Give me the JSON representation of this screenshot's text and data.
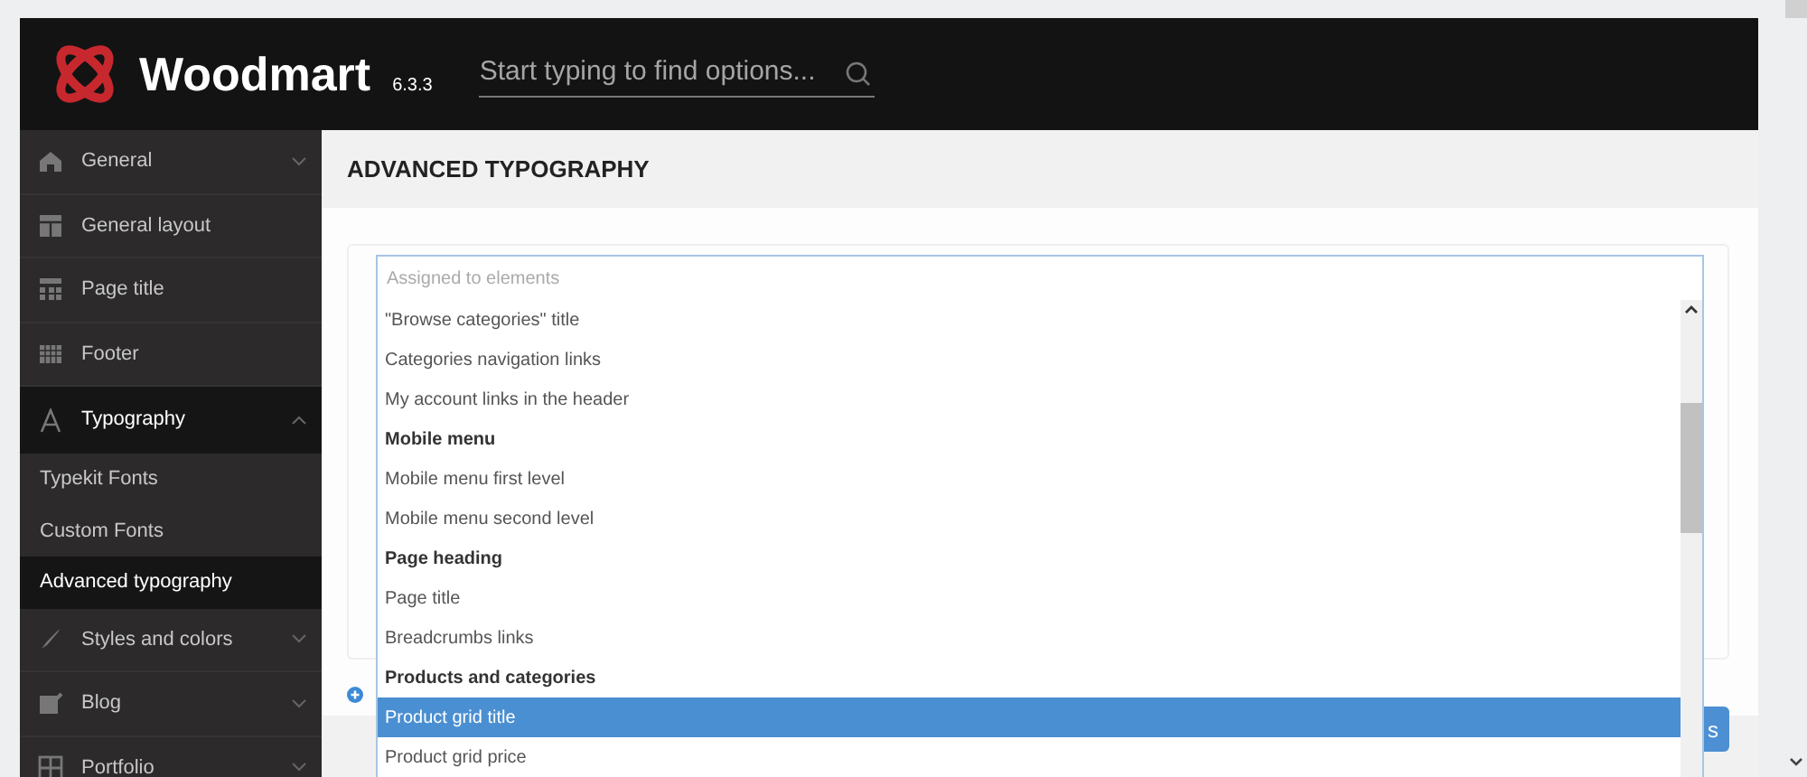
{
  "header": {
    "brand": "Woodmart",
    "version": "6.3.3",
    "search": {
      "placeholder": "Start typing to find options..."
    }
  },
  "sidebar": {
    "items": [
      {
        "label": "General",
        "expanded": false,
        "selected": false
      },
      {
        "label": "General layout",
        "selected": false
      },
      {
        "label": "Page title",
        "selected": false
      },
      {
        "label": "Footer",
        "selected": false
      },
      {
        "label": "Typography",
        "expanded": true,
        "selected": true,
        "children": [
          {
            "label": "Typekit Fonts",
            "selected": false
          },
          {
            "label": "Custom Fonts",
            "selected": false
          },
          {
            "label": "Advanced typography",
            "selected": true
          }
        ]
      },
      {
        "label": "Styles and colors",
        "expanded": false,
        "selected": false
      },
      {
        "label": "Blog",
        "expanded": false,
        "selected": false
      },
      {
        "label": "Portfolio",
        "expanded": false,
        "selected": false
      }
    ]
  },
  "section_title": "ADVANCED TYPOGRAPHY",
  "dropdown": {
    "placeholder": "Assigned to elements",
    "options": [
      {
        "label": "\"Browse categories\" title",
        "kind": "option",
        "selected": false
      },
      {
        "label": "Categories navigation links",
        "kind": "option",
        "selected": false
      },
      {
        "label": "My account links in the header",
        "kind": "option",
        "selected": false
      },
      {
        "label": "Mobile menu",
        "kind": "group",
        "selected": false
      },
      {
        "label": "Mobile menu first level",
        "kind": "option",
        "selected": false
      },
      {
        "label": "Mobile menu second level",
        "kind": "option",
        "selected": false
      },
      {
        "label": "Page heading",
        "kind": "group",
        "selected": false
      },
      {
        "label": "Page title",
        "kind": "option",
        "selected": false
      },
      {
        "label": "Breadcrumbs links",
        "kind": "option",
        "selected": false
      },
      {
        "label": "Products and categories",
        "kind": "group",
        "selected": false
      },
      {
        "label": "Product grid title",
        "kind": "option",
        "selected": true
      },
      {
        "label": "Product grid price",
        "kind": "option",
        "selected": false
      }
    ]
  },
  "save_button": "s"
}
